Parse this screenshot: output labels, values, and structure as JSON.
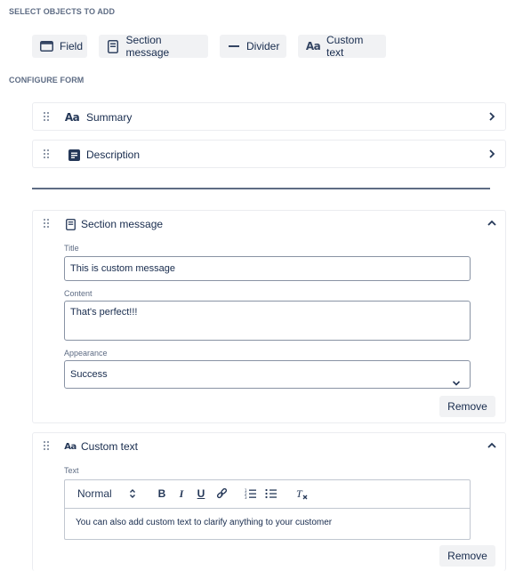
{
  "headings": {
    "select_objects": "SELECT OBJECTS TO ADD",
    "configure_form": "CONFIGURE FORM"
  },
  "add_buttons": [
    {
      "label": "Field",
      "icon": "field-icon"
    },
    {
      "label": "Section message",
      "icon": "section-message-icon"
    },
    {
      "label": "Divider",
      "icon": "divider-icon"
    },
    {
      "label": "Custom text",
      "icon": "custom-text-icon",
      "icon_text": "Aa"
    }
  ],
  "form_items": {
    "summary": {
      "label": "Summary",
      "icon_text": "Aa",
      "state": "collapsed"
    },
    "description": {
      "label": "Description",
      "icon": "description-icon",
      "state": "collapsed"
    },
    "section_message": {
      "label": "Section message",
      "icon": "section-message-icon",
      "state": "expanded",
      "title_label": "Title",
      "title_value": "This is custom message",
      "content_label": "Content",
      "content_value": "That's perfect!!!",
      "appearance_label": "Appearance",
      "appearance_value": "Success",
      "remove_label": "Remove"
    },
    "custom_text": {
      "label": "Custom text",
      "icon_text": "Aa",
      "state": "expanded",
      "text_label": "Text",
      "format_value": "Normal",
      "toolbar": {
        "bold": "B",
        "italic": "I",
        "underline": "U"
      },
      "editor_value": "You can also add custom text to clarify anything to your customer",
      "remove_label": "Remove"
    }
  },
  "colors": {
    "text": "#172b4d",
    "muted": "#5e6c84",
    "button_bg": "#f1f2f4",
    "border": "#ebecf0"
  }
}
